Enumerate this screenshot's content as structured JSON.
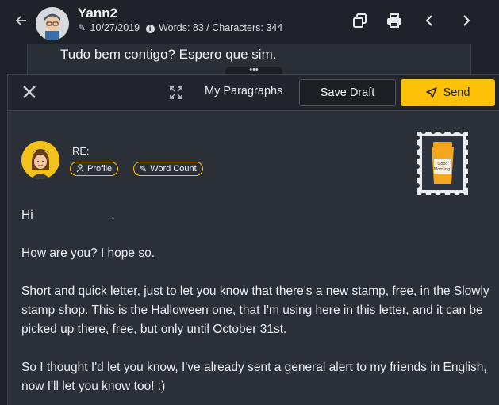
{
  "header": {
    "back_icon": "arrow-left-icon",
    "sender_name": "Yann2",
    "date": "10/27/2019",
    "stats": "Words: 83 / Characters: 344",
    "icons": [
      "copy-icon",
      "print-icon",
      "chevron-left-icon",
      "chevron-right-icon"
    ]
  },
  "previous_letter": {
    "preview_text": "Tudo bem contigo? Espero que sim.",
    "handle": "•••"
  },
  "composer": {
    "toolbar": {
      "paragraphs_label": "My Paragraphs",
      "save_draft_label": "Save Draft",
      "send_label": "Send"
    },
    "recipient": {
      "re_label": "RE:",
      "profile_label": "Profile",
      "word_count_label": "Word Count"
    },
    "stamp_text": "Good Morning!",
    "body": {
      "greeting": "Hi",
      "greeting_suffix": ",",
      "paragraphs": [
        "How are you? I hope so.",
        "Short and quick letter, just to let you know that there's a new stamp, free, in the Slowly stamp shop. This is the Halloween one, that I'm using here in this letter, and it can be picked up there, free, but only until October 31st.",
        "So I thought I'd let you know, I've already sent a general alert to my friends in English, now I'll let you know too! :)"
      ]
    }
  },
  "colors": {
    "accent": "#ffc107",
    "background": "#1f2329",
    "panel": "#2b3038",
    "toolbar": "#22262c"
  }
}
